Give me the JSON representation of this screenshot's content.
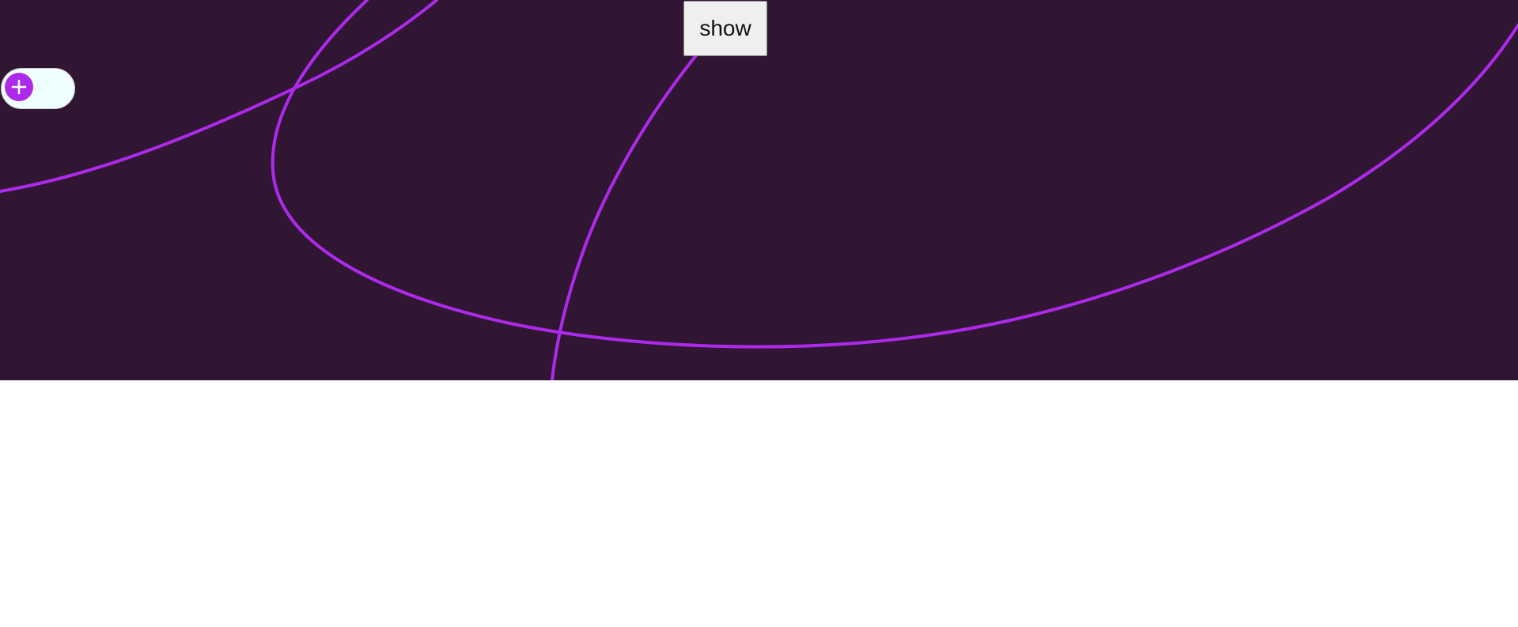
{
  "colors": {
    "canvas_background": "#311634",
    "curve_stroke": "#ad2aea",
    "toggle_background": "#effefe",
    "toggle_knob": "#ad2aea",
    "toggle_knob_icon": "#ffffff"
  },
  "show_button": {
    "label": "show"
  },
  "add_toggle": {
    "icon": "plus-icon",
    "state": "off"
  }
}
